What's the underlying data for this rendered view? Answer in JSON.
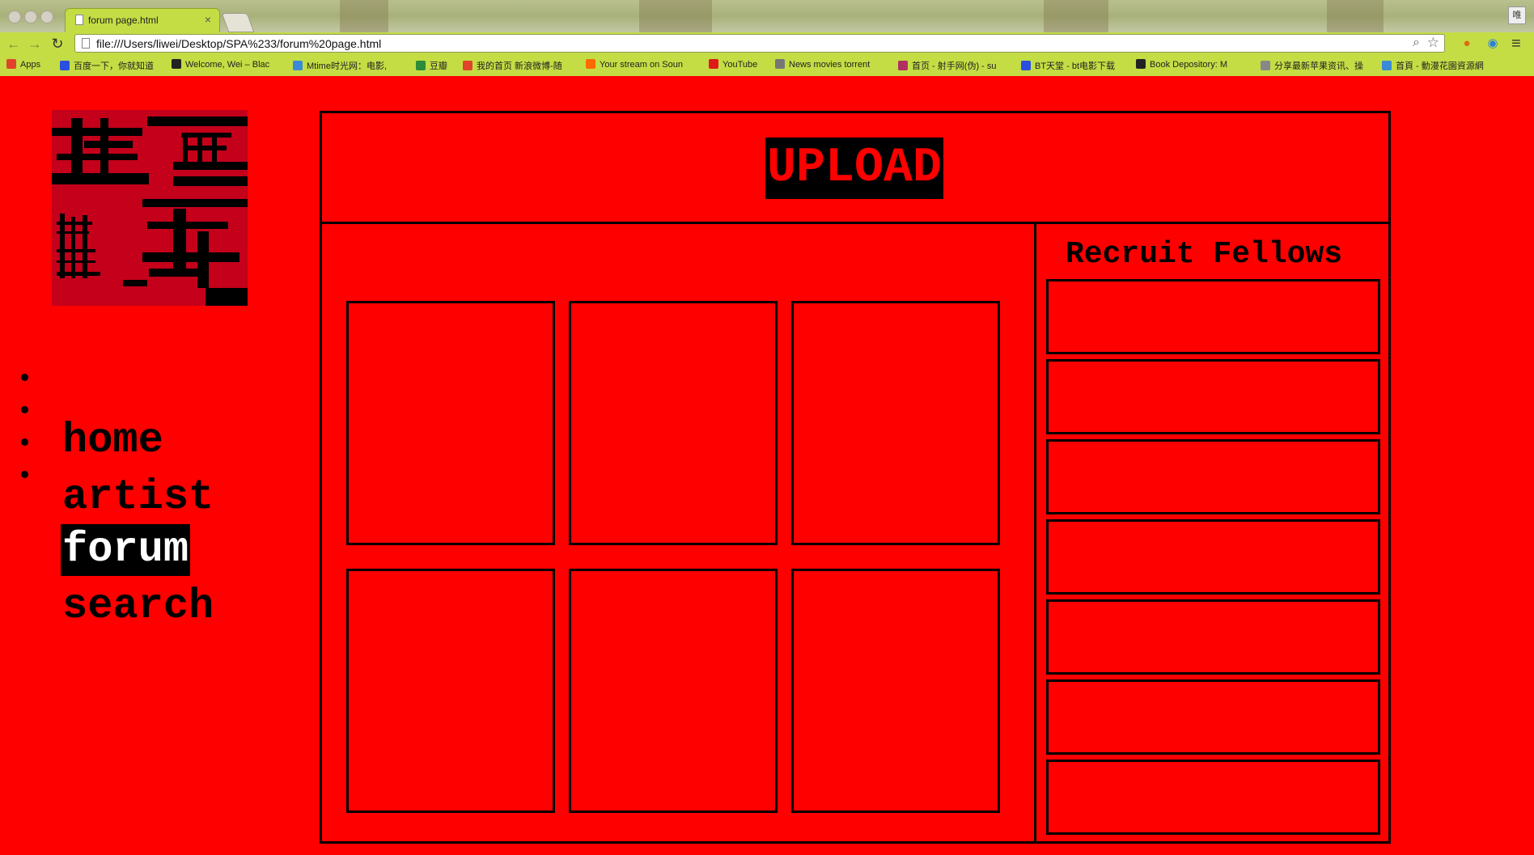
{
  "browser": {
    "tab_title": "forum page.html",
    "tab_close": "×",
    "url": "file:///Users/liwei/Desktop/SPA%233/forum%20page.html",
    "profile_label": "唯"
  },
  "bookmarks": [
    {
      "label": "Apps",
      "color": "#e0442a"
    },
    {
      "label": "百度一下，你就知道",
      "color": "#2a4fe0"
    },
    {
      "label": "Welcome, Wei – Blac",
      "color": "#222222"
    },
    {
      "label": "Mtime时光网：电影,",
      "color": "#3a8ad8"
    },
    {
      "label": "豆瓣",
      "color": "#2e8b3a"
    },
    {
      "label": "我的首页 新浪微博-随",
      "color": "#e0442a"
    },
    {
      "label": "Your stream on Soun",
      "color": "#ff6a00"
    },
    {
      "label": "YouTube",
      "color": "#e01919"
    },
    {
      "label": "News movies torrent",
      "color": "#777777"
    },
    {
      "label": "首页 - 射手网(伪) - su",
      "color": "#b03060"
    },
    {
      "label": "BT天堂 - bt电影下载",
      "color": "#2a4fe0"
    },
    {
      "label": "Book Depository: M",
      "color": "#222222"
    },
    {
      "label": "分享最新苹果资讯、操",
      "color": "#888888"
    },
    {
      "label": "首頁 - 動漫花園資源網",
      "color": "#3a8ad8"
    }
  ],
  "nav": {
    "items": [
      {
        "label": "home",
        "active": false
      },
      {
        "label": "artist",
        "active": false
      },
      {
        "label": "forum",
        "active": true
      },
      {
        "label": "search",
        "active": false
      }
    ]
  },
  "main": {
    "upload_label": "UPLOAD",
    "recruit_title": "Recruit Fellows",
    "card_count": 6,
    "slot_count": 7
  },
  "colors": {
    "page_background": "#ff0000",
    "logo_background": "#c4001b",
    "chrome_accent": "#c4dd44"
  }
}
